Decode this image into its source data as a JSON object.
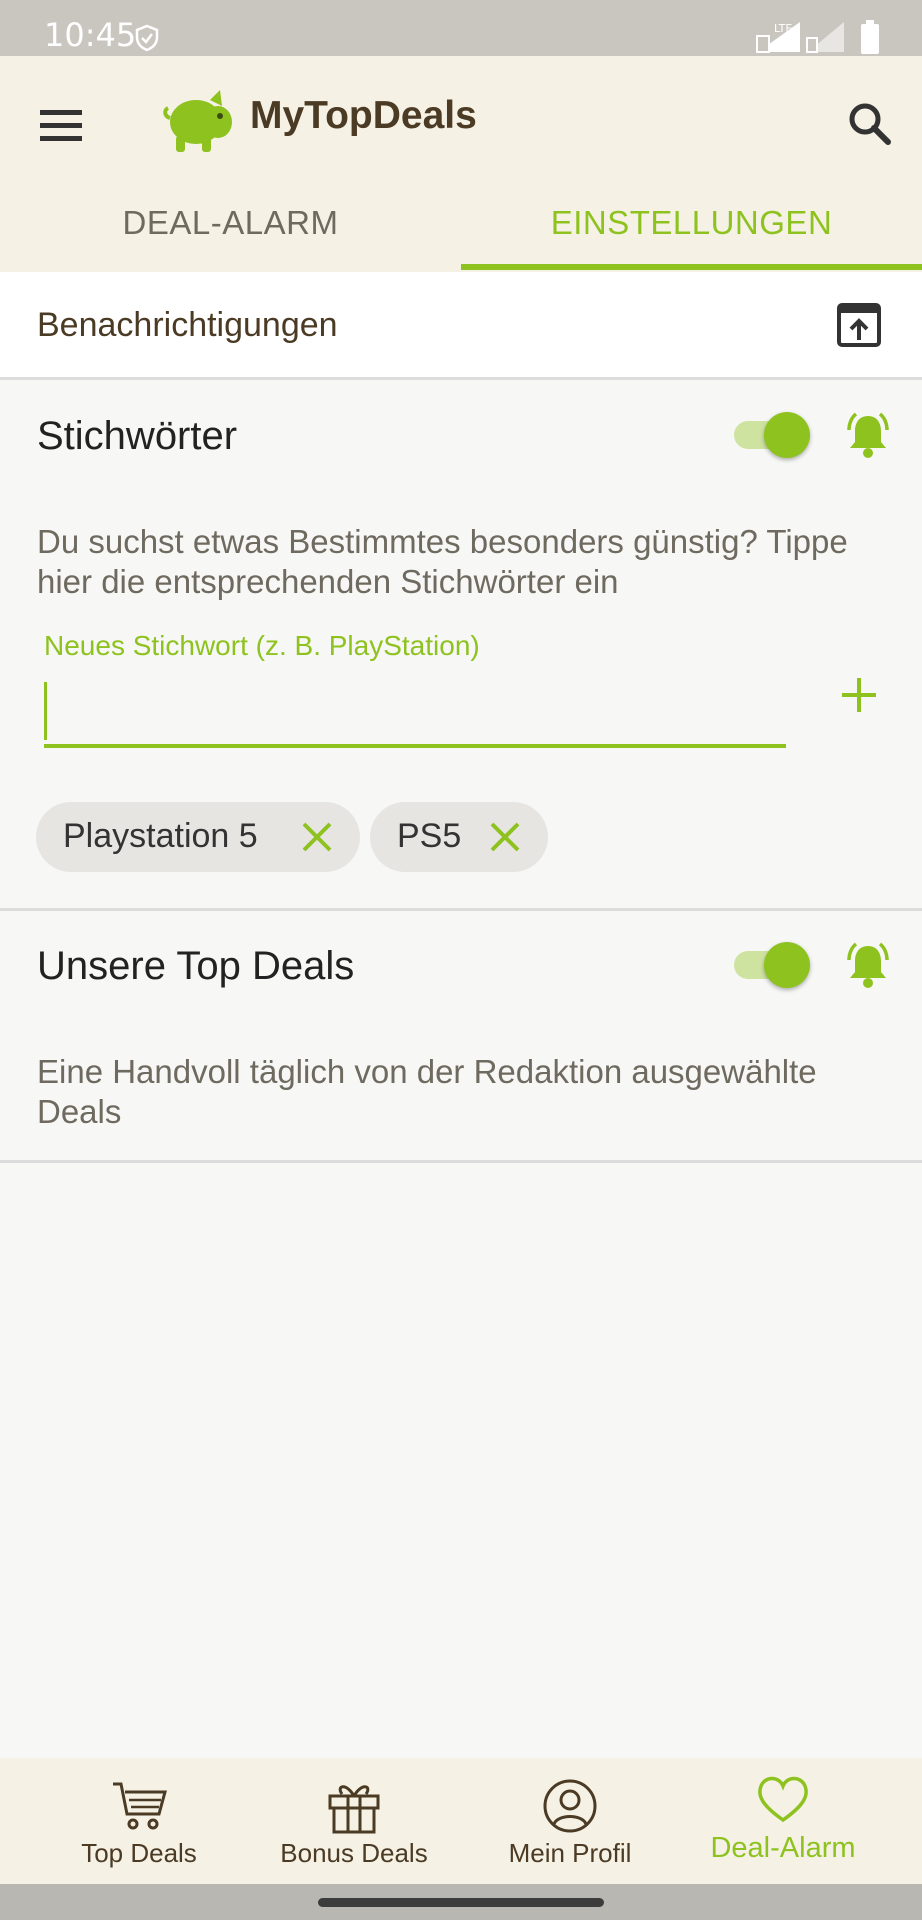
{
  "status_bar": {
    "time": "10:45",
    "network": "LTE"
  },
  "app_bar": {
    "title": "MyTopDeals"
  },
  "tabs": [
    {
      "label": "DEAL-ALARM",
      "active": false
    },
    {
      "label": "EINSTELLUNGEN",
      "active": true
    }
  ],
  "notifications": {
    "label": "Benachrichtigungen"
  },
  "keywords_section": {
    "title": "Stichwörter",
    "enabled": true,
    "description": "Du suchst etwas Bestimmtes besonders günstig? Tippe hier die entsprechenden Stichwörter ein",
    "input_label": "Neues Stichwort (z. B. PlayStation)",
    "input_value": "",
    "chips": [
      {
        "label": "Playstation 5"
      },
      {
        "label": "PS5"
      }
    ]
  },
  "top_deals_section": {
    "title": "Unsere Top Deals",
    "enabled": true,
    "description": "Eine Handvoll täglich von der Redaktion ausgewählte Deals"
  },
  "bottom_nav": [
    {
      "label": "Top Deals",
      "icon": "cart-icon",
      "active": false
    },
    {
      "label": "Bonus Deals",
      "icon": "gift-icon",
      "active": false
    },
    {
      "label": "Mein Profil",
      "icon": "profile-icon",
      "active": false
    },
    {
      "label": "Deal-Alarm",
      "icon": "heart-icon",
      "active": true
    }
  ],
  "colors": {
    "accent": "#8ec21f",
    "app_bar_bg": "#f5f1e5",
    "brand_text": "#4b3a24",
    "status_bar_bg": "#c9c6c0"
  }
}
